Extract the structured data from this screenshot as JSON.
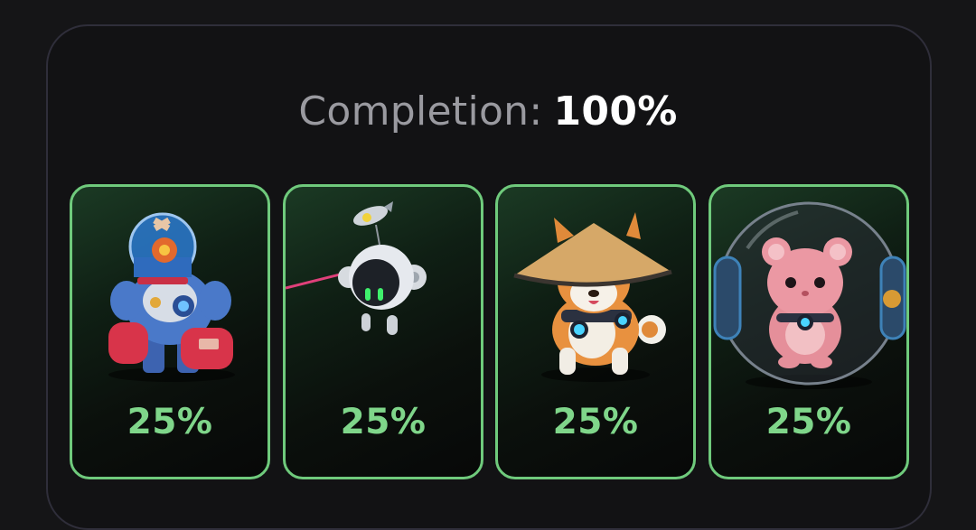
{
  "completion": {
    "label": "Completion:",
    "value": "100%"
  },
  "cards": [
    {
      "name": "robot-diver",
      "icon": "robot-diver-icon",
      "percent": "25%"
    },
    {
      "name": "drone-bot",
      "icon": "drone-bot-icon",
      "percent": "25%"
    },
    {
      "name": "shiba-doge",
      "icon": "shiba-doge-icon",
      "percent": "25%"
    },
    {
      "name": "hamster-ball",
      "icon": "hamster-ball-icon",
      "percent": "25%"
    }
  ],
  "colors": {
    "accent_green": "#6fca7c",
    "percent_text": "#7fd68a",
    "panel_border": "#2f2e3a",
    "background": "#151517"
  }
}
